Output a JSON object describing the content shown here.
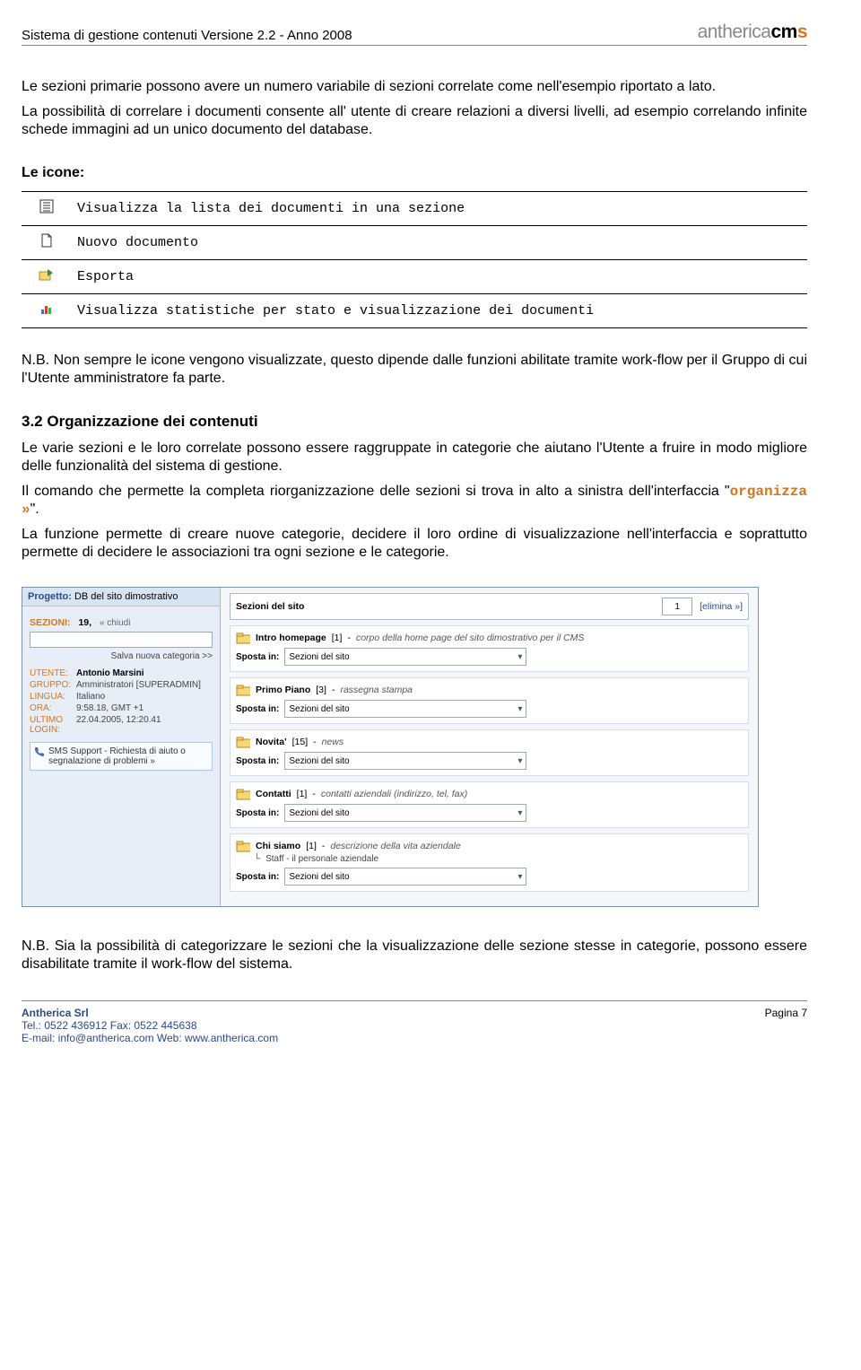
{
  "header": {
    "left": "Sistema di gestione contenuti Versione 2.2 - Anno 2008",
    "brand_gray": "antherica",
    "brand_black": "cm",
    "brand_orange": "s"
  },
  "intro": {
    "p1": "Le sezioni primarie possono avere un numero variabile di sezioni correlate come nell'esempio riportato a lato.",
    "p2": "La possibilità di correlare i documenti consente all' utente di creare relazioni a diversi livelli, ad esempio correlando infinite schede immagini ad un unico documento del database."
  },
  "icons_heading": "Le icone:",
  "icons": [
    {
      "name": "list-icon",
      "desc": "Visualizza la lista dei documenti in una sezione"
    },
    {
      "name": "new-doc-icon",
      "desc": "Nuovo documento"
    },
    {
      "name": "export-icon",
      "desc": "Esporta"
    },
    {
      "name": "stats-icon",
      "desc": "Visualizza statistiche per stato e visualizzazione dei documenti"
    }
  ],
  "nb1": "N.B. Non sempre le icone vengono visualizzate, questo dipende dalle funzioni abilitate tramite work-flow per il Gruppo di cui l'Utente amministratore fa parte.",
  "section32_heading": "3.2 Organizzazione dei contenuti",
  "section32_p1": "Le varie sezioni e le loro correlate possono essere raggruppate in categorie che aiutano l'Utente a fruire in modo migliore delle funzionalità del sistema di gestione.",
  "section32_p2_pre": "Il comando che permette la completa riorganizzazione delle sezioni si trova in alto a sinistra dell'interfaccia \"",
  "section32_cmd": "organizza »",
  "section32_p2_post": "\".",
  "section32_p3": "La funzione permette di creare nuove categorie, decidere il loro ordine di visualizzazione nell'interfaccia e soprattutto permette di decidere le associazioni tra ogni sezione e le categorie.",
  "nb2": "N.B. Sia la possibilità di categorizzare le sezioni che la visualizzazione delle sezione stesse in categorie, possono essere disabilitate tramite il work-flow del sistema.",
  "screenshot": {
    "project_label": "Progetto:",
    "project_name": "DB del sito dimostrativo",
    "sez_label": "SEZIONI:",
    "sez_count": "19,",
    "sez_close": "« chiudi",
    "save_cat": "Salva nuova categoria >>",
    "side": {
      "utente_l": "UTENTE:",
      "utente_v": "Antonio Marsini",
      "gruppo_l": "GRUPPO:",
      "gruppo_v": "Amministratori [SUPERADMIN]",
      "lingua_l": "LINGUA:",
      "lingua_v": "Italiano",
      "ora_l": "ORA:",
      "ora_v": "9:58.18, GMT +1",
      "login_l": "ULTIMO LOGIN:",
      "login_v": "22.04.2005, 12:20.41"
    },
    "sms": "SMS Support - Richiesta di aiuto o segnalazione di problemi »",
    "main_top_label": "Sezioni del sito",
    "main_top_page": "1",
    "main_top_del": "[elimina »]",
    "move_label": "Sposta in:",
    "move_target": "Sezioni del sito",
    "sections": [
      {
        "name": "Intro homepage",
        "count": "[1]",
        "desc": "corpo della home page del sito dimostrativo per il CMS"
      },
      {
        "name": "Primo Piano",
        "count": "[3]",
        "desc": "rassegna stampa"
      },
      {
        "name": "Novita'",
        "count": "[15]",
        "desc": "news"
      },
      {
        "name": "Contatti",
        "count": "[1]",
        "desc": "contatti aziendali (indirizzo, tel, fax)"
      },
      {
        "name": "Chi siamo",
        "count": "[1]",
        "desc": "descrizione della vita aziendale",
        "sub": "Staff - il personale aziendale"
      }
    ]
  },
  "footer": {
    "company": "Antherica Srl",
    "tel": "Tel.: 0522 436912  Fax: 0522 445638",
    "email": "E-mail: info@antherica.com  Web: www.antherica.com",
    "page": "Pagina 7"
  }
}
